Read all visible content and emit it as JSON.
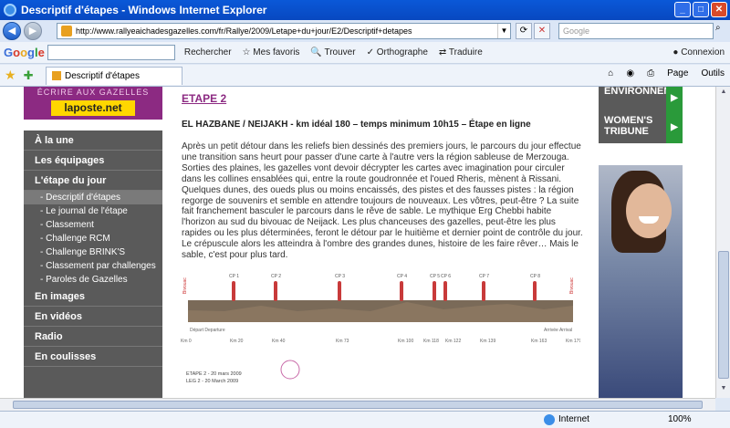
{
  "window": {
    "title": "Descriptif d'étapes - Windows Internet Explorer"
  },
  "nav": {
    "url": "http://www.rallyeaichadesgazelles.com/fr/Rallye/2009/Letape+du+jour/E2/Descriptif+detapes",
    "search_placeholder": "Google"
  },
  "google_bar": {
    "logo": "Google",
    "search_label": "Rechercher",
    "favorites": "Mes favoris",
    "find": "Trouver",
    "spell": "Orthographe",
    "translate": "Traduire",
    "login": "Connexion"
  },
  "tab": {
    "title": "Descriptif d'étapes"
  },
  "commands": {
    "page": "Page",
    "tools": "Outils"
  },
  "status": {
    "zone": "Internet",
    "zoom": "100%"
  },
  "page": {
    "ad_header": "ÉCRIRE AUX GAZELLES",
    "ad_logo": "laposte.net",
    "sidebar": [
      {
        "label": "À la une",
        "type": "section"
      },
      {
        "label": "Les équipages",
        "type": "section"
      },
      {
        "label": "L'étape du jour",
        "type": "section"
      },
      {
        "label": "- Descriptif d'étapes",
        "type": "sub",
        "active": true
      },
      {
        "label": "- Le journal de l'étape",
        "type": "sub"
      },
      {
        "label": "- Classement",
        "type": "sub"
      },
      {
        "label": "- Challenge RCM",
        "type": "sub"
      },
      {
        "label": "- Challenge BRINK'S",
        "type": "sub"
      },
      {
        "label": "- Classement par challenges",
        "type": "sub"
      },
      {
        "label": "- Paroles de Gazelles",
        "type": "sub"
      },
      {
        "label": "En images",
        "type": "section"
      },
      {
        "label": "En vidéos",
        "type": "section"
      },
      {
        "label": "Radio",
        "type": "section"
      },
      {
        "label": "En coulisses",
        "type": "section"
      }
    ],
    "etape_title": "ETAPE 2",
    "etape_sub": "EL HAZBANE / NEIJAKH - km idéal 180 – temps minimum 10h15 – Étape en ligne",
    "stage_text": "Après un petit détour dans les reliefs bien dessinés des premiers jours, le parcours du jour effectue une transition sans heurt pour passer d'une carte à l'autre vers la région sableuse de Merzouga. Sorties des plaines, les gazelles vont devoir décrypter les cartes avec imagination pour circuler dans les collines ensablées qui, entre la route goudronnée et l'oued Rheris, mènent à Rissani. Quelques dunes, des oueds plus ou moins encaissés, des pistes et des fausses pistes : la région regorge de souvenirs et semble en attendre toujours de nouveaux. Les vôtres, peut-être ? La suite fait franchement basculer le parcours dans le rêve de sable. Le mythique Erg Chebbi habite l'horizon au sud du bivouac de Neijack. Les plus chanceuses des gazelles, peut-être les plus rapides ou les plus déterminées, feront le détour par le huitième et dernier point de contrôle du jour. Le crépuscule alors les atteindra à l'ombre des grandes dunes, histoire de les faire rêver… Mais le sable, c'est pour plus tard.",
    "profile": {
      "checkpoints": [
        "CP 1",
        "CP 2",
        "CP 3",
        "CP 4",
        "CP 5",
        "CP 6",
        "CP 7",
        "CP 8"
      ],
      "km_labels": [
        "Km 0",
        "Km 20",
        "Km 40",
        "Km 73",
        "Km 100",
        "Km 118",
        "Km 122",
        "Km 139",
        "Km 163",
        "Km 179"
      ],
      "start": "Départ Departure",
      "end": "Arrivée Arrival",
      "bivouac": "Bivouac",
      "date_fr": "ETAPE 2 - 20 mars 2009",
      "date_en": "LEG 2 - 20 March 2009"
    },
    "ads": {
      "env": "ENVIRONNEMENT",
      "women": "WOMEN'S TRIBUNE"
    }
  }
}
